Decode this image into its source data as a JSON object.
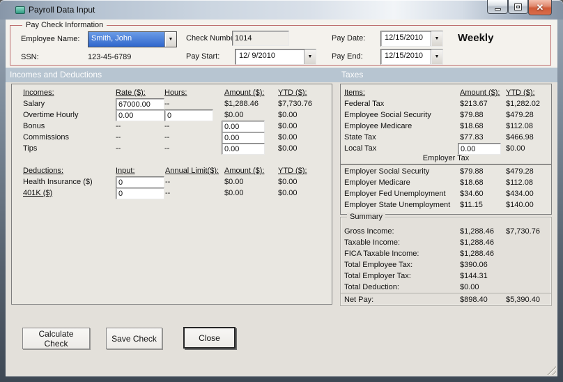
{
  "window": {
    "title": "Payroll Data Input",
    "controls": {
      "close_glyph": "✕"
    }
  },
  "icons": {
    "dropdown_arrow": "▼",
    "app_icon": "payroll-app-icon"
  },
  "colors": {
    "group_border": "#bd6e6e",
    "section_bar": "#b7c5d1",
    "combo_selection": "#2f66cc",
    "close_button": "#cf5a38"
  },
  "paycheck": {
    "group_label": "Pay Check Information",
    "employee_name_label": "Employee Name:",
    "employee_name_value": "Smith, John",
    "ssn_label": "SSN:",
    "ssn_value": "123-45-6789",
    "check_number_label": "Check Number:",
    "check_number_value": "1014",
    "pay_start_label": "Pay Start:",
    "pay_start_value": "12/ 9/2010",
    "pay_date_label": "Pay Date:",
    "pay_date_value": "12/15/2010",
    "pay_end_label": "Pay End:",
    "pay_end_value": "12/15/2010",
    "frequency": "Weekly"
  },
  "section_headers": {
    "left": "Incomes and Deductions",
    "right": "Taxes"
  },
  "incomes": {
    "headers": {
      "name": "Incomes:",
      "rate": "Rate ($):",
      "hours": "Hours:",
      "amount": "Amount ($):",
      "ytd": "YTD ($):"
    },
    "rows": [
      {
        "label": "Salary",
        "rate_input": "67000.00",
        "hours_text": "--",
        "amount_text": "$1,288.46",
        "ytd": "$7,730.76"
      },
      {
        "label": "Overtime Hourly",
        "rate_input": "0.00",
        "hours_input": "0",
        "amount_text": "$0.00",
        "ytd": "$0.00"
      },
      {
        "label": "Bonus",
        "rate_text": "--",
        "hours_text": "--",
        "amount_input": "0.00",
        "ytd": "$0.00"
      },
      {
        "label": "Commissions",
        "rate_text": "--",
        "hours_text": "--",
        "amount_input": "0.00",
        "ytd": "$0.00"
      },
      {
        "label": "Tips",
        "rate_text": "--",
        "hours_text": "--",
        "amount_input": "0.00",
        "ytd": "$0.00"
      }
    ]
  },
  "deductions": {
    "headers": {
      "name": "Deductions:",
      "input": "Input:",
      "annual_limit": "Annual Limit($):",
      "amount": "Amount ($):",
      "ytd": "YTD ($):"
    },
    "rows": [
      {
        "label": "Health Insurance ($)",
        "input_value": "0",
        "annual_limit": "--",
        "amount": "$0.00",
        "ytd": "$0.00"
      },
      {
        "label": "401K ($)",
        "input_value": "0",
        "annual_limit": "--",
        "amount": "$0.00",
        "ytd": "$0.00"
      }
    ]
  },
  "taxes": {
    "headers": {
      "items": "Items:",
      "amount": "Amount ($):",
      "ytd": "YTD ($):"
    },
    "employee_rows": [
      {
        "label": "Federal Tax",
        "amount": "$213.67",
        "ytd": "$1,282.02"
      },
      {
        "label": "Employee Social Security",
        "amount": "$79.88",
        "ytd": "$479.28"
      },
      {
        "label": "Employee Medicare",
        "amount": "$18.68",
        "ytd": "$112.08"
      },
      {
        "label": "State Tax",
        "amount": "$77.83",
        "ytd": "$466.98"
      }
    ],
    "local_tax": {
      "label": "Local Tax",
      "amount_input": "0.00",
      "ytd": "$0.00"
    },
    "employer_divider": "Employer Tax",
    "employer_rows": [
      {
        "label": "Employer Social Security",
        "amount": "$79.88",
        "ytd": "$479.28"
      },
      {
        "label": "Employer Medicare",
        "amount": "$18.68",
        "ytd": "$112.08"
      },
      {
        "label": "Employer Fed Unemployment",
        "amount": "$34.60",
        "ytd": "$434.00"
      },
      {
        "label": "Employer State Unemployment",
        "amount": "$11.15",
        "ytd": "$140.00"
      }
    ]
  },
  "summary": {
    "group_label": "Summary",
    "rows": [
      {
        "label": "Gross Income:",
        "amount": "$1,288.46",
        "ytd": "$7,730.76"
      },
      {
        "label": "Taxable Income:",
        "amount": "$1,288.46"
      },
      {
        "label": "FICA Taxable Income:",
        "amount": "$1,288.46"
      },
      {
        "label": "Total Employee Tax:",
        "amount": "$390.06"
      },
      {
        "label": "Total Employer Tax:",
        "amount": "$144.31"
      },
      {
        "label": "Total Deduction:",
        "amount": "$0.00"
      },
      {
        "label": "Net Pay:",
        "amount": "$898.40",
        "ytd": "$5,390.40"
      }
    ]
  },
  "actions": {
    "calculate": "Calculate Check",
    "save": "Save Check",
    "close": "Close"
  }
}
